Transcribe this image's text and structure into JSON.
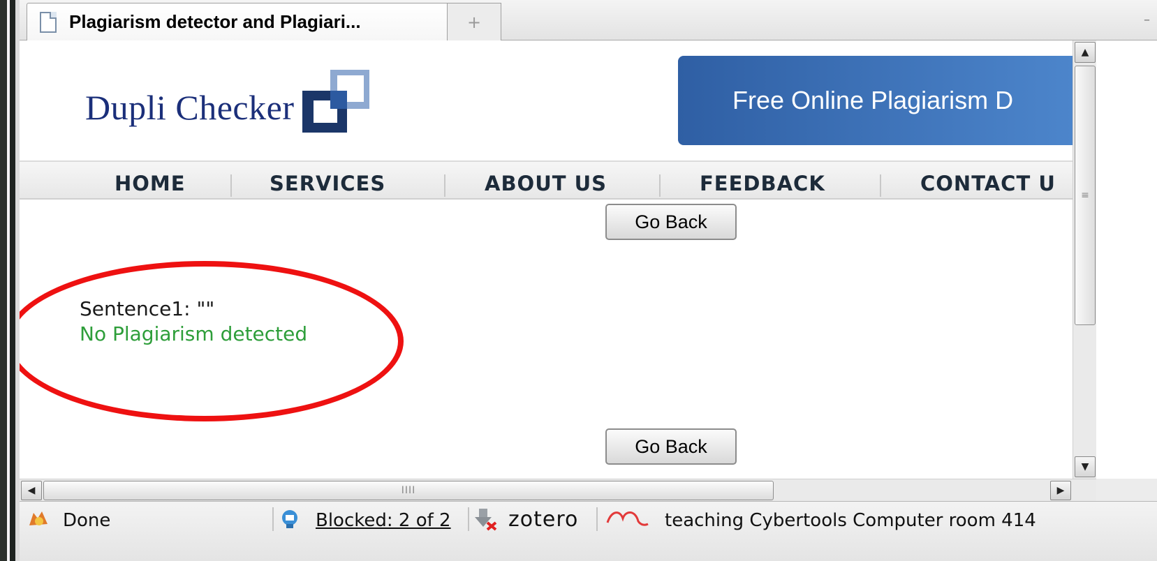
{
  "browser": {
    "tab_title": "Plagiarism detector and Plagiari...",
    "new_tab_symbol": "+",
    "tab_list_symbol": "–"
  },
  "site": {
    "logo_text": "Dupli Checker",
    "hero_text": "Free Online Plagiarism D",
    "nav": [
      "HOME",
      "SERVICES",
      "ABOUT US",
      "FEEDBACK",
      "CONTACT U"
    ]
  },
  "content": {
    "go_back_label": "Go Back",
    "sentence_label": "Sentence1: \"\"",
    "result_text": "No Plagiarism detected",
    "result_color": "#2e9e3a",
    "highlight_color": "#ee1111"
  },
  "scrollbars": {
    "up_arrow": "▲",
    "down_arrow": "▼",
    "left_arrow": "◀",
    "right_arrow": "▶",
    "v_grip": "≡",
    "h_grip": "IIII"
  },
  "statusbar": {
    "status": "Done",
    "blocked": "Blocked: 2 of 2",
    "zotero": "zotero",
    "extra": "teaching Cybertools Computer room 414"
  },
  "colors": {
    "brand_blue": "#1b2f7a",
    "hero_blue": "#2f5fa4"
  }
}
